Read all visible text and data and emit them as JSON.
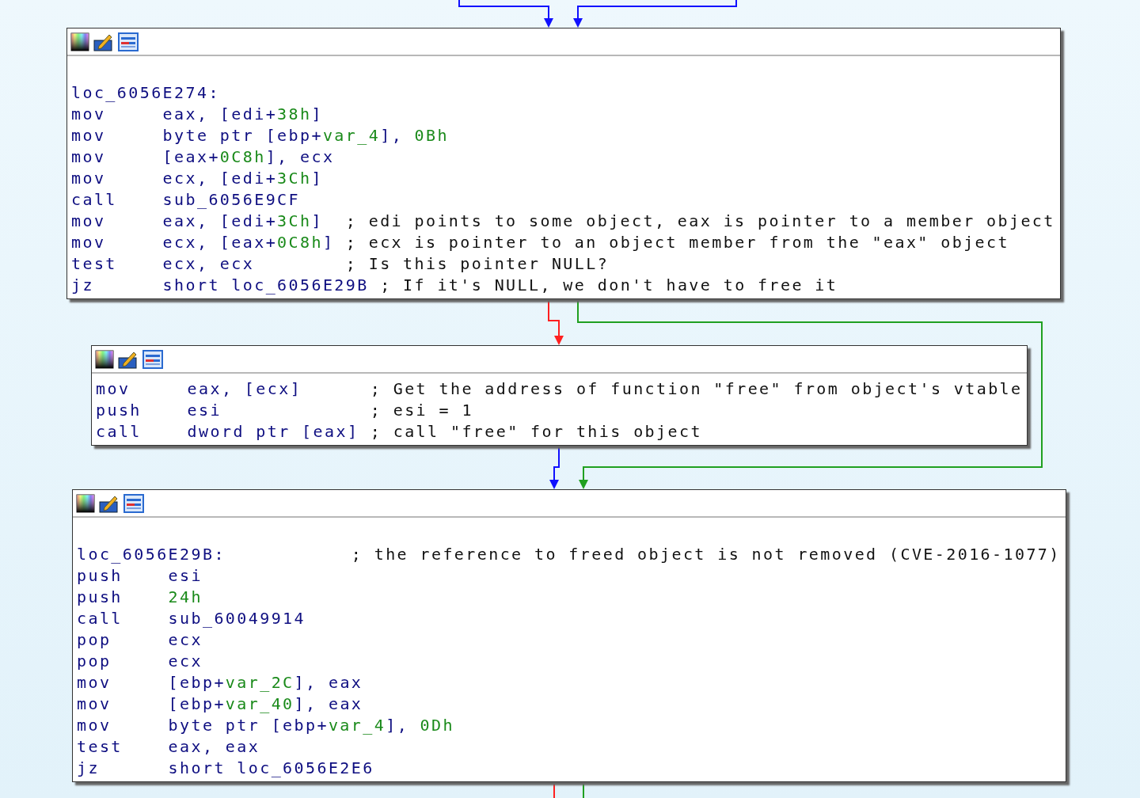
{
  "graph": {
    "nodes": [
      {
        "label": "loc_6056E274:",
        "lines": [
          {
            "mnemonic": "mov",
            "operand": [
              {
                "text": "eax, [edi+"
              },
              {
                "text": "38h",
                "kind": "const"
              },
              {
                "text": "]"
              }
            ]
          },
          {
            "mnemonic": "mov",
            "operand": [
              {
                "text": "byte ptr [ebp+"
              },
              {
                "text": "var_4",
                "kind": "const"
              },
              {
                "text": "], "
              },
              {
                "text": "0Bh",
                "kind": "const"
              }
            ]
          },
          {
            "mnemonic": "mov",
            "operand": [
              {
                "text": "[eax+"
              },
              {
                "text": "0C8h",
                "kind": "const"
              },
              {
                "text": "], ecx"
              }
            ]
          },
          {
            "mnemonic": "mov",
            "operand": [
              {
                "text": "ecx, [edi+"
              },
              {
                "text": "3Ch",
                "kind": "const"
              },
              {
                "text": "]"
              }
            ]
          },
          {
            "mnemonic": "call",
            "operand": [
              {
                "text": "sub_6056E9CF"
              }
            ]
          },
          {
            "mnemonic": "mov",
            "operand": [
              {
                "text": "eax, [edi+"
              },
              {
                "text": "3Ch",
                "kind": "const"
              },
              {
                "text": "]"
              }
            ],
            "comment": "; edi points to some object, eax is pointer to a member object"
          },
          {
            "mnemonic": "mov",
            "operand": [
              {
                "text": "ecx, [eax+"
              },
              {
                "text": "0C8h",
                "kind": "const"
              },
              {
                "text": "]"
              }
            ],
            "comment": "; ecx is pointer to an object member from the \"eax\" object"
          },
          {
            "mnemonic": "test",
            "operand": [
              {
                "text": "ecx, ecx"
              }
            ],
            "comment": "; Is this pointer NULL?"
          },
          {
            "mnemonic": "jz",
            "operand": [
              {
                "text": "short loc_6056E29B"
              }
            ],
            "comment": "; If it's NULL, we don't have to free it"
          }
        ]
      },
      {
        "lines": [
          {
            "mnemonic": "mov",
            "operand": [
              {
                "text": "eax, [ecx]"
              }
            ],
            "comment": "; Get the address of function \"free\" from object's vtable"
          },
          {
            "mnemonic": "push",
            "operand": [
              {
                "text": "esi"
              }
            ],
            "comment": "; esi = 1"
          },
          {
            "mnemonic": "call",
            "operand": [
              {
                "text": "dword ptr [eax]"
              }
            ],
            "comment": "; call \"free\" for this object"
          }
        ]
      },
      {
        "label": "loc_6056E29B:",
        "label_comment": "; the reference to freed object is not removed (CVE-2016-1077)",
        "lines": [
          {
            "mnemonic": "push",
            "operand": [
              {
                "text": "esi"
              }
            ]
          },
          {
            "mnemonic": "push",
            "operand": [
              {
                "text": "24h",
                "kind": "const"
              }
            ]
          },
          {
            "mnemonic": "call",
            "operand": [
              {
                "text": "sub_60049914"
              }
            ]
          },
          {
            "mnemonic": "pop",
            "operand": [
              {
                "text": "ecx"
              }
            ]
          },
          {
            "mnemonic": "pop",
            "operand": [
              {
                "text": "ecx"
              }
            ]
          },
          {
            "mnemonic": "mov",
            "operand": [
              {
                "text": "[ebp+"
              },
              {
                "text": "var_2C",
                "kind": "const"
              },
              {
                "text": "], eax"
              }
            ]
          },
          {
            "mnemonic": "mov",
            "operand": [
              {
                "text": "[ebp+"
              },
              {
                "text": "var_40",
                "kind": "const"
              },
              {
                "text": "], eax"
              }
            ]
          },
          {
            "mnemonic": "mov",
            "operand": [
              {
                "text": "byte ptr [ebp+"
              },
              {
                "text": "var_4",
                "kind": "const"
              },
              {
                "text": "], "
              },
              {
                "text": "0Dh",
                "kind": "const"
              }
            ]
          },
          {
            "mnemonic": "test",
            "operand": [
              {
                "text": "eax, eax"
              }
            ]
          },
          {
            "mnemonic": "jz",
            "operand": [
              {
                "text": "short loc_6056E2E6"
              }
            ]
          }
        ]
      }
    ]
  }
}
